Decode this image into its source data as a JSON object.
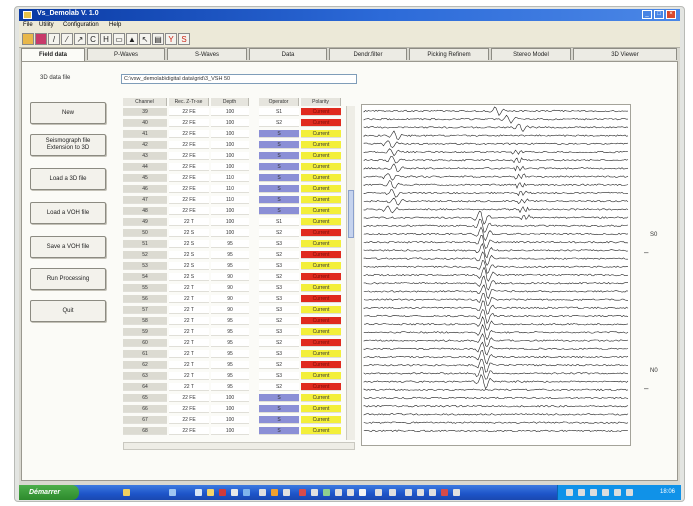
{
  "window": {
    "title": "Vs_Demolab V. 1.0"
  },
  "menu": [
    "File",
    "Utility",
    "Configuration",
    "Help"
  ],
  "toolbar_icons": [
    "open-icon",
    "stop-icon",
    "line-icon",
    "diagonal-icon",
    "pick-icon",
    "marker-c-icon",
    "marker-h-icon",
    "window-icon",
    "triangle-icon",
    "pointer-icon",
    "print-icon",
    "filter-icon",
    "settings-icon"
  ],
  "tabs": [
    "Field data",
    "P-Waves",
    "S-Waves",
    "Data",
    "Dendr.filter",
    "Picking Refinem",
    "Stereo Model",
    "3D Viewer"
  ],
  "field_panel": {
    "list_label": "3D data file",
    "path": "C:\\vsw_demolab\\digital data\\grid\\3_VSH 50",
    "buttons": [
      "New",
      "Seismograph file Extension to 3D",
      "Load a 3D file",
      "Load a VOH file",
      "Save a VOH file",
      "Run Processing",
      "Quit"
    ]
  },
  "table": {
    "headers": [
      "Channel",
      "Rec. Z-Tr-se",
      "Depth",
      "Operator",
      "Polarity"
    ],
    "rows": [
      [
        "39",
        "22 FE",
        "100",
        "S1",
        "Current",
        "white",
        "red"
      ],
      [
        "40",
        "22 FE",
        "100",
        "S2",
        "Current",
        "white",
        "red"
      ],
      [
        "41",
        "22 FE",
        "100",
        "S",
        "Current",
        "blue",
        "yellow"
      ],
      [
        "42",
        "22 FE",
        "100",
        "S",
        "Current",
        "blue",
        "yellow"
      ],
      [
        "43",
        "22 FE",
        "100",
        "S",
        "Current",
        "blue",
        "yellow"
      ],
      [
        "44",
        "22 FE",
        "100",
        "S",
        "Current",
        "blue",
        "yellow"
      ],
      [
        "45",
        "22 FE",
        "110",
        "S",
        "Current",
        "blue",
        "yellow"
      ],
      [
        "46",
        "22 FE",
        "110",
        "S",
        "Current",
        "blue",
        "yellow"
      ],
      [
        "47",
        "22 FE",
        "110",
        "S",
        "Current",
        "blue",
        "yellow"
      ],
      [
        "48",
        "22 FE",
        "100",
        "S",
        "Current",
        "blue",
        "yellow"
      ],
      [
        "49",
        "22 T",
        "100",
        "S1",
        "Current",
        "white",
        "yellow"
      ],
      [
        "50",
        "22 S",
        "100",
        "S2",
        "Current",
        "white",
        "red"
      ],
      [
        "51",
        "22 S",
        "95",
        "S3",
        "Current",
        "white",
        "yellow"
      ],
      [
        "52",
        "22 S",
        "95",
        "S2",
        "Current",
        "white",
        "red"
      ],
      [
        "53",
        "22 S",
        "95",
        "S3",
        "Current",
        "white",
        "yellow"
      ],
      [
        "54",
        "22 S",
        "90",
        "S2",
        "Current",
        "white",
        "red"
      ],
      [
        "55",
        "22 T",
        "90",
        "S3",
        "Current",
        "white",
        "yellow"
      ],
      [
        "56",
        "22 T",
        "90",
        "S3",
        "Current",
        "white",
        "red"
      ],
      [
        "57",
        "22 T",
        "90",
        "S3",
        "Current",
        "white",
        "yellow"
      ],
      [
        "58",
        "22 T",
        "95",
        "S2",
        "Current",
        "white",
        "red"
      ],
      [
        "59",
        "22 T",
        "95",
        "S3",
        "Current",
        "white",
        "yellow"
      ],
      [
        "60",
        "22 T",
        "95",
        "S2",
        "Current",
        "white",
        "red"
      ],
      [
        "61",
        "22 T",
        "95",
        "S3",
        "Current",
        "white",
        "yellow"
      ],
      [
        "62",
        "22 T",
        "95",
        "S2",
        "Current",
        "white",
        "red"
      ],
      [
        "63",
        "22 T",
        "95",
        "S3",
        "Current",
        "white",
        "yellow"
      ],
      [
        "64",
        "22 T",
        "95",
        "S2",
        "Current",
        "white",
        "red"
      ],
      [
        "65",
        "22 FE",
        "100",
        "S",
        "Current",
        "blue",
        "yellow"
      ],
      [
        "66",
        "22 FE",
        "100",
        "S",
        "Current",
        "blue",
        "yellow"
      ],
      [
        "67",
        "22 FE",
        "100",
        "S",
        "Current",
        "blue",
        "yellow"
      ],
      [
        "68",
        "22 FE",
        "100",
        "S",
        "Current",
        "blue",
        "yellow"
      ]
    ]
  },
  "viewer": {
    "markers": [
      "S0",
      "N0"
    ],
    "trace_count": 40
  },
  "colors": {
    "title_bar": "#1447bd",
    "operator_blue": "#8b8fd6",
    "polarity_yellow": "#f3ef3a",
    "polarity_red": "#e02a1e",
    "taskbar": "#2459cf"
  },
  "taskbar": {
    "start_label": "Démarrer",
    "clock": "18:06"
  }
}
